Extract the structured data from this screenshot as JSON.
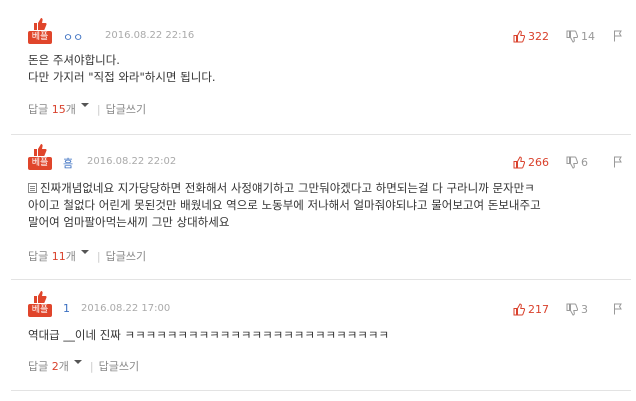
{
  "badge_label": "베플",
  "reply_label": "답글",
  "reply_unit": "개",
  "write_reply_label": "답글쓰기",
  "colors": {
    "badge": "#e0452b",
    "upvote": "#d9412c",
    "nick": "#3a6fc1"
  },
  "icons": {
    "badge": "thumbs-up-icon",
    "upvote": "thumbs-up-icon",
    "downvote": "thumbs-down-icon",
    "report": "flag-icon",
    "reply_expand": "chevron-down-icon"
  },
  "comments": [
    {
      "nick": "ㅇㅇ",
      "date": "2016.08.22 22:16",
      "up": "322",
      "down": "14",
      "lines": [
        "돈은 주셔야합니다.",
        "다만 가지러 \"직접 와라\"하시면 됩니다."
      ],
      "reply_count": "15"
    },
    {
      "nick": "흠",
      "date": "2016.08.22 22:02",
      "up": "266",
      "down": "6",
      "lines": [
        "진짜개념없네요 지가당당하면 전화해서 사정얘기하고 그만둬야겠다고 하면되는걸 다 구라니까 문자만ㅋ",
        "아이고 철없다 어린게 못된것만 배웠네요 역으로 노동부에 저나해서 얼마줘야되냐고 물어보고여 돈보내주고",
        "말어여 엄마팔아먹는새끼 그만 상대하세요"
      ],
      "reply_count": "11"
    },
    {
      "nick": "1",
      "date": "2016.08.22 17:00",
      "up": "217",
      "down": "3",
      "lines": [
        "역대급 __이네 진짜 ㅋㅋㅋㅋㅋㅋㅋㅋㅋㅋㅋㅋㅋㅋㅋㅋㅋㅋㅋㅋㅋㅋㅋㅋㅋ"
      ],
      "reply_count": "2"
    }
  ]
}
